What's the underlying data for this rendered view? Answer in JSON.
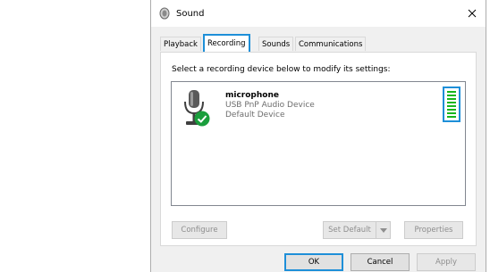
{
  "window": {
    "title": "Sound"
  },
  "tabs": [
    {
      "label": "Playback"
    },
    {
      "label": "Recording",
      "active": true
    },
    {
      "label": "Sounds"
    },
    {
      "label": "Communications"
    }
  ],
  "panel": {
    "instruction": "Select a recording device below to modify its settings:"
  },
  "devices": [
    {
      "name": "microphone",
      "description": "USB PnP Audio Device",
      "status": "Default Device",
      "icon": "microphone-icon",
      "badge": "checkmark-icon",
      "level": 1.0
    }
  ],
  "panel_buttons": {
    "configure": "Configure",
    "set_default": "Set Default",
    "properties": "Properties"
  },
  "dialog_buttons": {
    "ok": "OK",
    "cancel": "Cancel",
    "apply": "Apply"
  },
  "colors": {
    "accent": "#1e8fd8",
    "level_green": "#17b51b",
    "check_green": "#1a9e3c"
  }
}
